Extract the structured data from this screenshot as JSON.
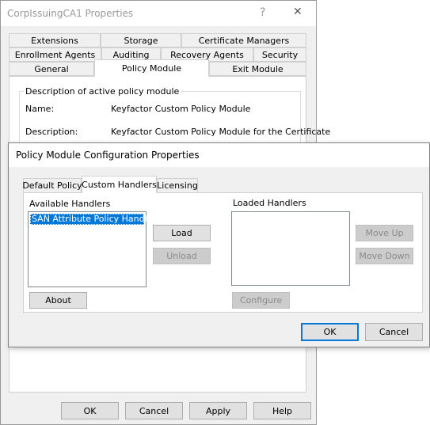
{
  "props": {
    "title": "CorpIssuingCA1 Properties",
    "help_glyph": "?",
    "close_glyph": "✕",
    "tabs_row1": [
      "Extensions",
      "Storage",
      "Certificate Managers"
    ],
    "tabs_row2": [
      "Enrollment Agents",
      "Auditing",
      "Recovery Agents",
      "Security"
    ],
    "tabs_row3": [
      "General",
      "Policy Module",
      "Exit Module"
    ],
    "selected_tab": "Policy Module",
    "group_label": "Description of active policy module",
    "name_label": "Name:",
    "name_value": "Keyfactor Custom Policy Module",
    "desc_label": "Description:",
    "desc_value": "Keyfactor Custom Policy Module for the Certificate",
    "buttons": {
      "ok": "OK",
      "cancel": "Cancel",
      "apply": "Apply",
      "help": "Help"
    }
  },
  "config": {
    "title": "Policy Module Configuration Properties",
    "tabs": [
      "Default Policy",
      "Custom Handlers",
      "Licensing"
    ],
    "selected_tab": "Custom Handlers",
    "available_label": "Available Handlers",
    "available_items": [
      "SAN Attribute Policy Handler"
    ],
    "loaded_label": "Loaded Handlers",
    "loaded_items": [],
    "buttons": {
      "load": "Load",
      "unload": "Unload",
      "about": "About",
      "configure": "Configure",
      "move_up": "Move Up",
      "move_down": "Move Down",
      "ok": "OK",
      "cancel": "Cancel"
    },
    "selection_color": "#0078d7"
  }
}
